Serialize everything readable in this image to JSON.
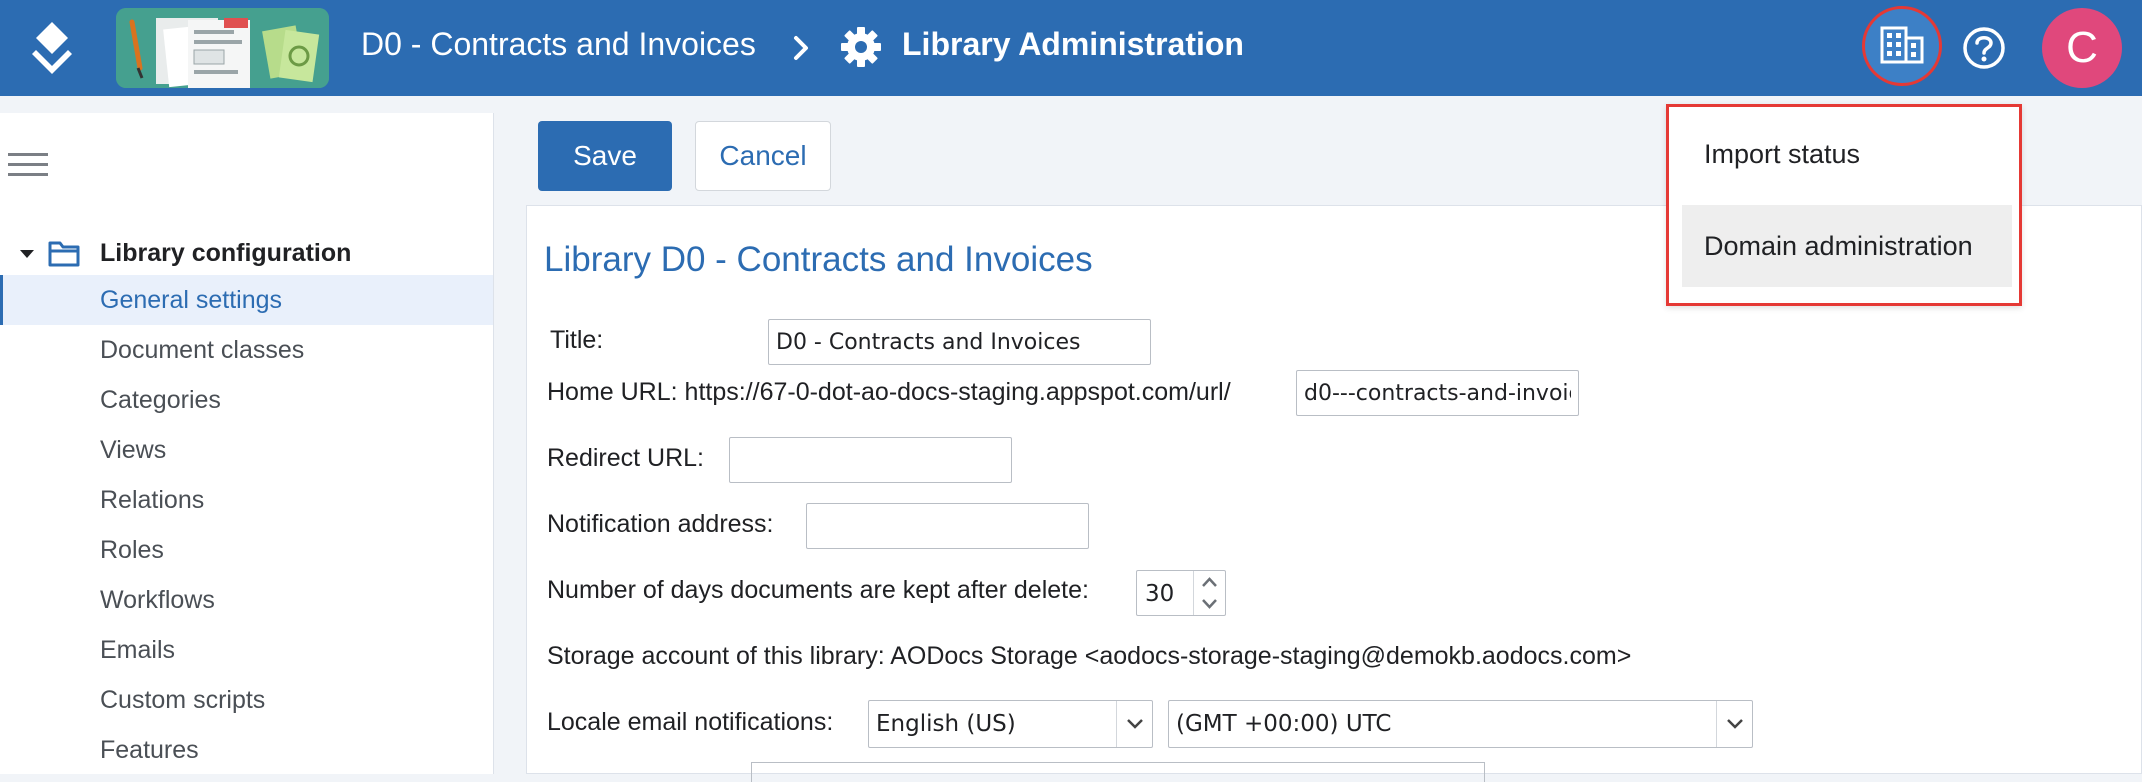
{
  "header": {
    "library_name": "D0 - Contracts and Invoices",
    "current_page": "Library Administration",
    "avatar_initial": "C",
    "brand_color": "#2c6cb2",
    "avatar_color": "#e0487c",
    "icons": {
      "logo": "app-logo-icon",
      "separator": "chevron-right-icon",
      "settings": "gear-icon",
      "domain": "building-icon",
      "help": "help-circle-icon"
    }
  },
  "user_menu": {
    "items": [
      {
        "label": "Import status"
      },
      {
        "label": "Domain administration"
      }
    ],
    "highlight_color": "#e53935"
  },
  "sidebar": {
    "menu_icon": "hamburger-icon",
    "root": {
      "label": "Library configuration",
      "icon": "folder-icon"
    },
    "items": [
      {
        "label": "General settings",
        "active": true
      },
      {
        "label": "Document classes"
      },
      {
        "label": "Categories"
      },
      {
        "label": "Views"
      },
      {
        "label": "Relations"
      },
      {
        "label": "Roles"
      },
      {
        "label": "Workflows"
      },
      {
        "label": "Emails"
      },
      {
        "label": "Custom scripts"
      },
      {
        "label": "Features"
      }
    ]
  },
  "toolbar": {
    "save_label": "Save",
    "cancel_label": "Cancel"
  },
  "form": {
    "heading": "Library D0 - Contracts and Invoices",
    "title_label": "Title:",
    "title_value": "D0 - Contracts and Invoices",
    "home_url_label": "Home URL: https://67-0-dot-ao-docs-staging.appspot.com/url/",
    "home_url_value": "d0---contracts-and-invoic",
    "redirect_url_label": "Redirect URL:",
    "redirect_url_value": "",
    "notification_label": "Notification address:",
    "notification_value": "",
    "days_kept_label": "Number of days documents are kept after delete:",
    "days_kept_value": "30",
    "storage_text": "Storage account of this library: AODocs Storage <aodocs-storage-staging@demokb.aodocs.com>",
    "locale_label": "Locale email notifications:",
    "locale_value": "English (US)",
    "timezone_value": "(GMT +00:00) UTC"
  }
}
